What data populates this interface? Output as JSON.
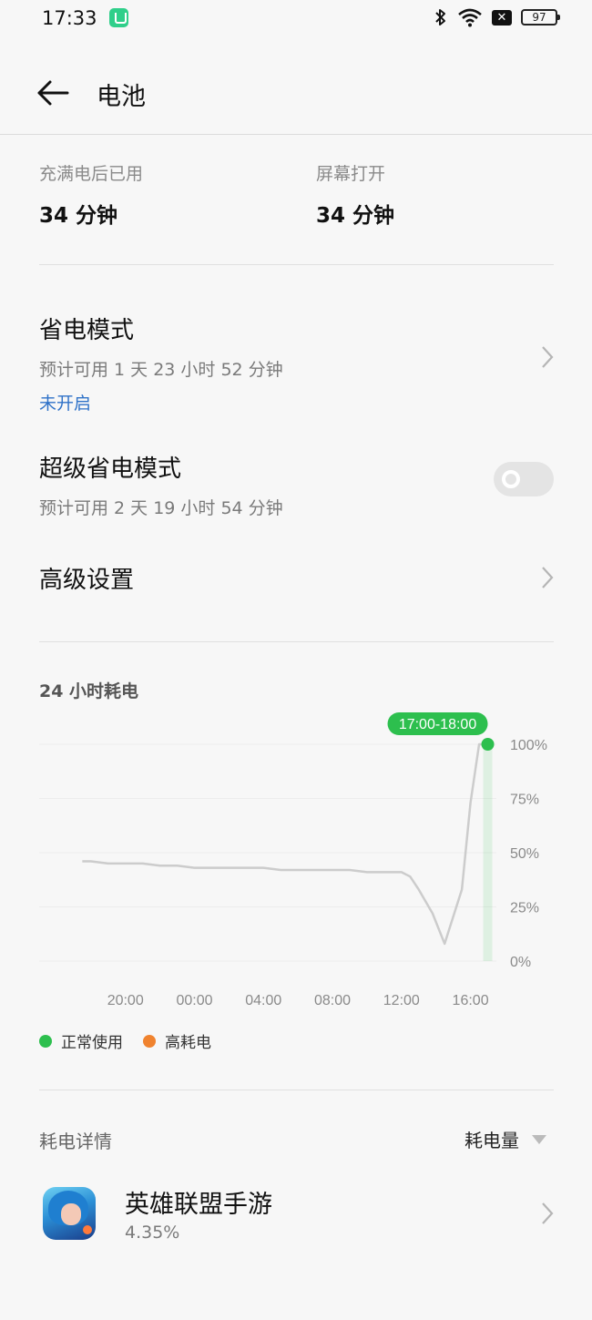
{
  "status_bar": {
    "time": "17:33",
    "battery": "97",
    "icons": [
      "app-notification-icon",
      "bluetooth-icon",
      "wifi-icon",
      "no-sim-icon",
      "battery-icon"
    ]
  },
  "header": {
    "back_icon": "arrow-left-icon",
    "title": "电池"
  },
  "usage": {
    "since_full_label": "充满电后已用",
    "since_full_value": "34 分钟",
    "screen_on_label": "屏幕打开",
    "screen_on_value": "34 分钟"
  },
  "power_saving": {
    "title": "省电模式",
    "estimate": "预计可用 1 天 23 小时 52 分钟",
    "status": "未开启"
  },
  "super_power_saving": {
    "title": "超级省电模式",
    "estimate": "预计可用 2 天 19 小时 54 分钟",
    "enabled": false
  },
  "advanced": {
    "title": "高级设置"
  },
  "chart_data": {
    "type": "line",
    "title": "24 小时耗电",
    "x_ticks": [
      "20:00",
      "00:00",
      "04:00",
      "08:00",
      "12:00",
      "16:00"
    ],
    "y_ticks": [
      "100%",
      "75%",
      "50%",
      "25%",
      "0%"
    ],
    "ylim": [
      0,
      100
    ],
    "series": [
      {
        "x_hours": [
          17.5,
          18,
          19,
          20,
          21,
          22,
          23,
          24,
          25,
          26,
          27,
          28,
          29,
          30,
          31,
          32,
          33,
          34,
          35,
          36,
          36.5,
          37,
          37.8,
          38.5,
          39.5,
          40,
          40.5,
          41
        ],
        "values": [
          46,
          46,
          45,
          45,
          45,
          44,
          44,
          43,
          43,
          43,
          43,
          43,
          42,
          42,
          42,
          42,
          42,
          41,
          41,
          41,
          39,
          33,
          22,
          8,
          33,
          73,
          100,
          100
        ]
      }
    ],
    "highlight_label": "17:00-18:00",
    "legend": [
      {
        "label": "正常使用",
        "color": "#2dbf4e"
      },
      {
        "label": "高耗电",
        "color": "#f0832f"
      }
    ],
    "colors": {
      "line": "#cccccc",
      "highlight": "#2dbf4e",
      "grid": "#ececec"
    }
  },
  "details": {
    "label": "耗电详情",
    "sort_label": "耗电量",
    "apps": [
      {
        "name": "英雄联盟手游",
        "percent": "4.35%"
      }
    ]
  }
}
